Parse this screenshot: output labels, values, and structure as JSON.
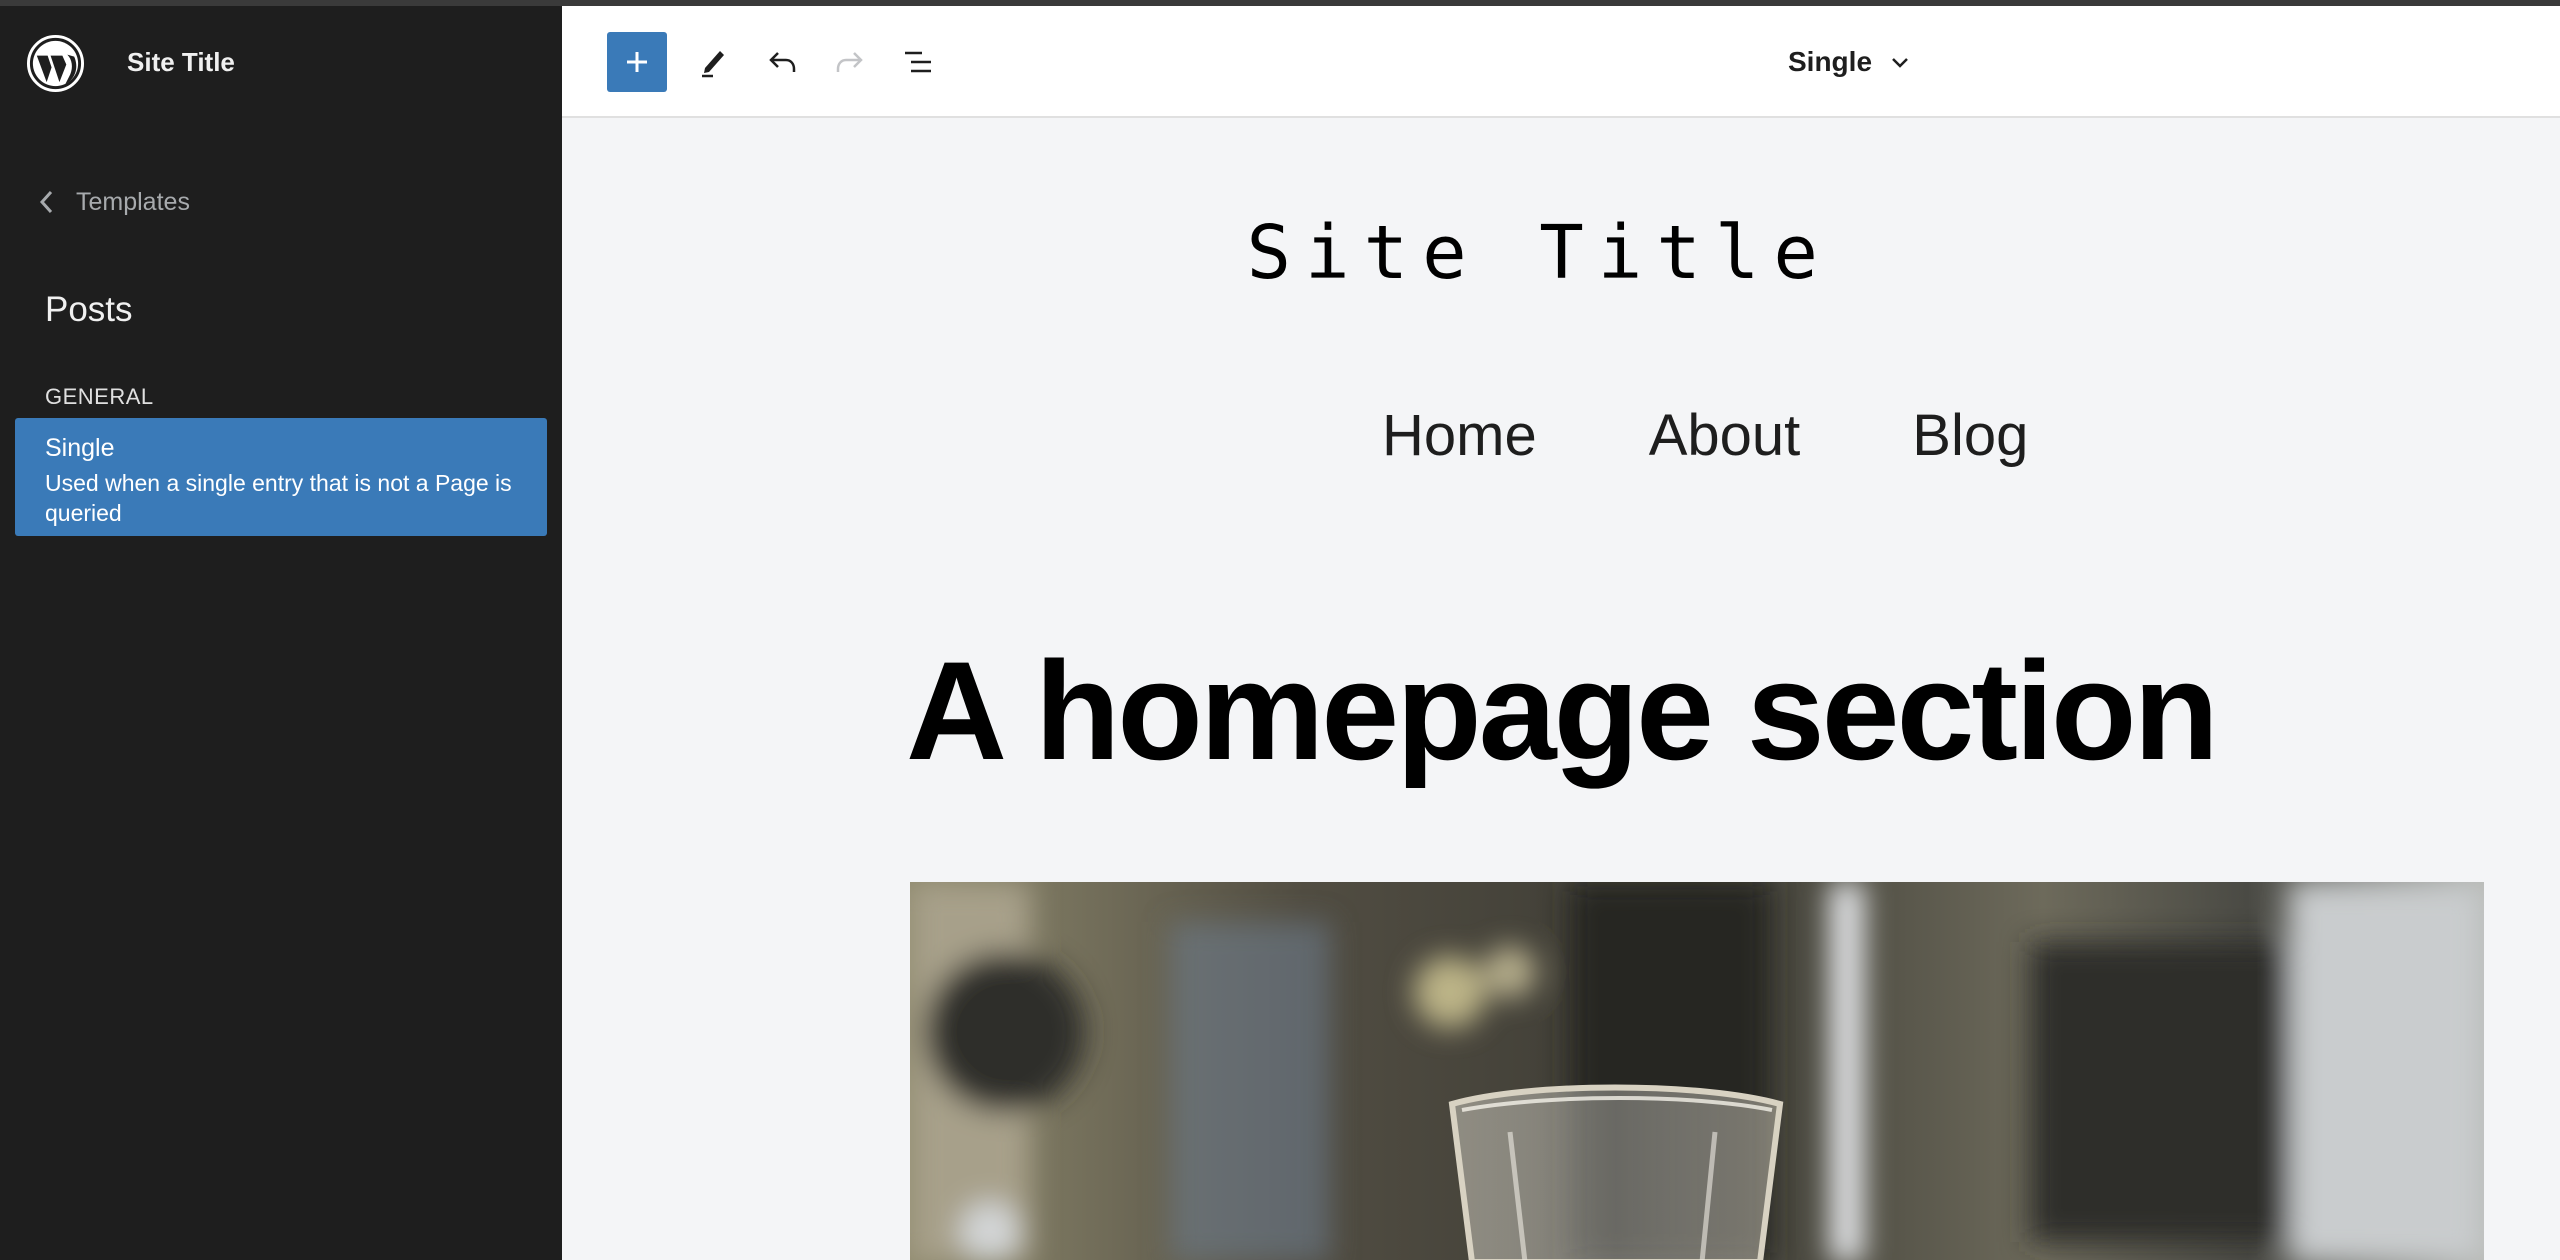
{
  "sidebar": {
    "site_title": "Site Title",
    "back_label": "Templates",
    "section_title": "Posts",
    "group_label": "GENERAL",
    "items": [
      {
        "title": "Single",
        "description": "Used when a single entry that is not a Page is queried"
      }
    ]
  },
  "toolbar": {
    "document_title": "Single"
  },
  "canvas": {
    "site_title": "Site Title",
    "nav": [
      "Home",
      "About",
      "Blog"
    ],
    "headline": "A homepage section"
  },
  "colors": {
    "sidebar_bg": "#1e1e1e",
    "accent": "#3a7ab8",
    "canvas_bg": "#f4f5f7"
  }
}
